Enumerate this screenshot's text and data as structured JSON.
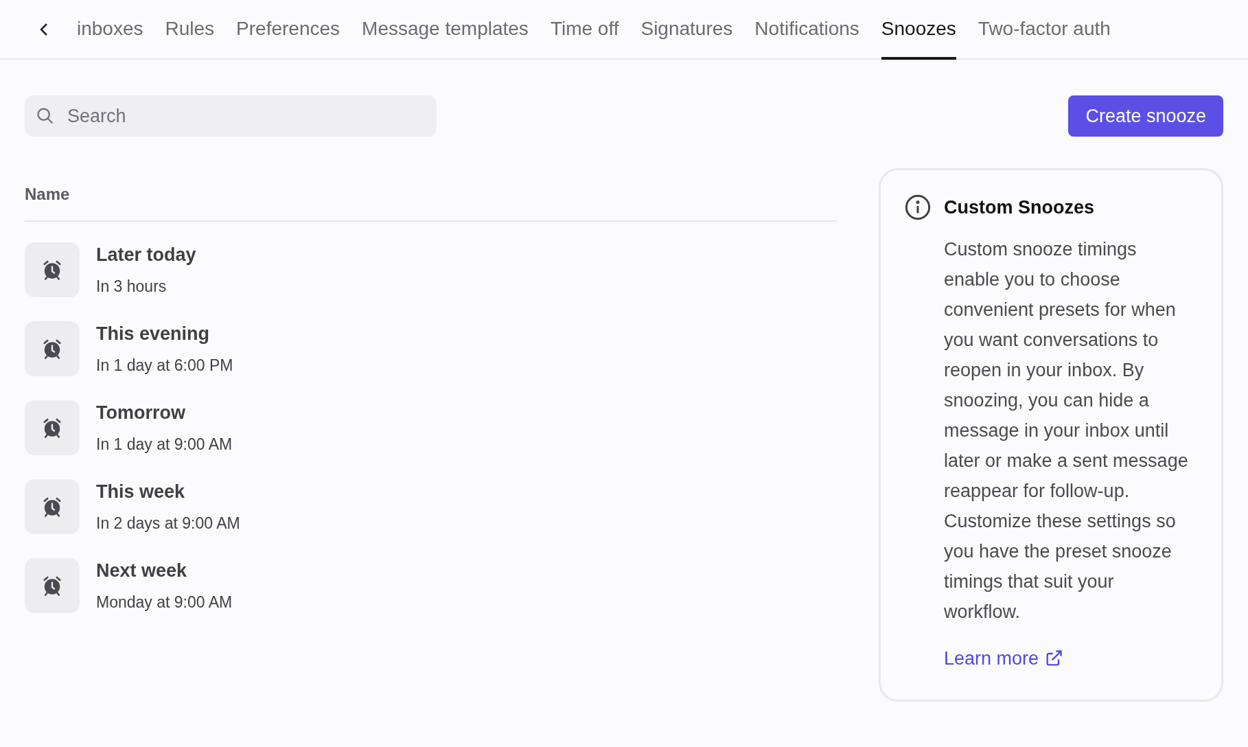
{
  "tabs": [
    {
      "label": "inboxes",
      "selected": false
    },
    {
      "label": "Rules",
      "selected": false
    },
    {
      "label": "Preferences",
      "selected": false
    },
    {
      "label": "Message templates",
      "selected": false
    },
    {
      "label": "Time off",
      "selected": false
    },
    {
      "label": "Signatures",
      "selected": false
    },
    {
      "label": "Notifications",
      "selected": false
    },
    {
      "label": "Snoozes",
      "selected": true
    },
    {
      "label": "Two-factor auth",
      "selected": false
    }
  ],
  "search": {
    "placeholder": "Search"
  },
  "create_button": "Create snooze",
  "list": {
    "column": "Name",
    "items": [
      {
        "title": "Later today",
        "subtitle": "In 3 hours"
      },
      {
        "title": "This evening",
        "subtitle": "In 1 day at 6:00 PM"
      },
      {
        "title": "Tomorrow",
        "subtitle": "In 1 day at 9:00 AM"
      },
      {
        "title": "This week",
        "subtitle": "In 2 days at 9:00 AM"
      },
      {
        "title": "Next week",
        "subtitle": "Monday at 9:00 AM"
      }
    ]
  },
  "info_card": {
    "title": "Custom Snoozes",
    "body": "Custom snooze timings enable you to choose convenient presets for when you want conversations to reopen in your inbox. By snoozing, you can hide a message in your inbox until later or make a sent message reappear for follow-up. Customize these settings so you have the preset snooze timings that suit your workflow.",
    "link": "Learn more"
  }
}
